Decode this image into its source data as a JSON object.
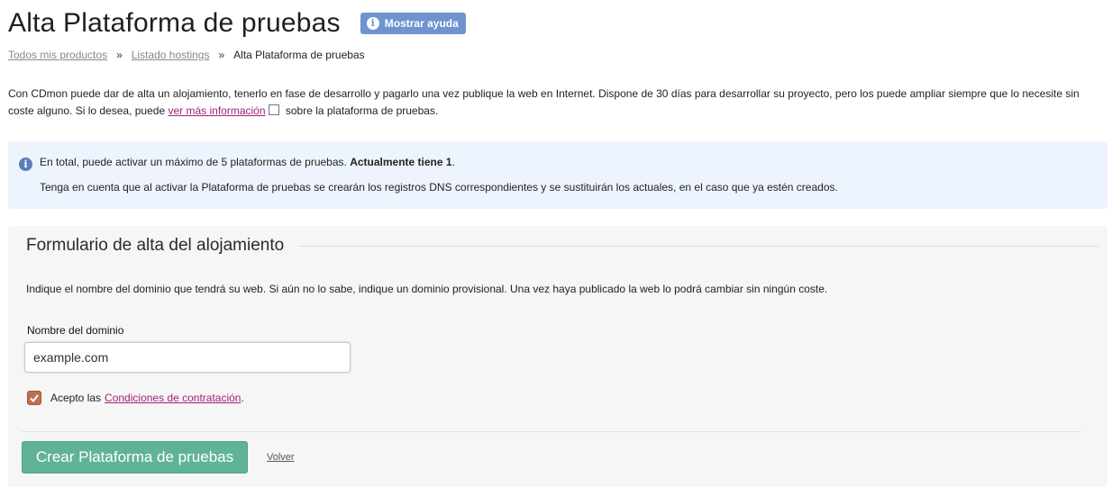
{
  "header": {
    "title": "Alta Plataforma de pruebas",
    "help_button": "Mostrar ayuda"
  },
  "breadcrumb": {
    "items": [
      "Todos mis productos",
      "Listado hostings",
      "Alta Plataforma de pruebas"
    ],
    "separator": "»"
  },
  "intro": {
    "text_before": "Con CDmon puede dar de alta un alojamiento, tenerlo en fase de desarrollo y pagarlo una vez publique la web en Internet. Dispone de 30 días para desarrollar su proyecto, pero los puede ampliar siempre que lo necesite sin coste alguno. Si lo desea, puede ",
    "link": "ver más información",
    "text_after": " sobre la plataforma de pruebas."
  },
  "info_box": {
    "line1_text": "En total, puede activar un máximo de 5 plataformas de pruebas. ",
    "line1_bold": "Actualmente tiene 1",
    "line1_end": ".",
    "line2": "Tenga en cuenta que al activar la Plataforma de pruebas se crearán los registros DNS correspondientes y se sustituirán los actuales, en el caso que ya estén creados."
  },
  "form": {
    "legend": "Formulario de alta del alojamiento",
    "description": "Indique el nombre del dominio que tendrá su web. Si aún no lo sabe, indique un dominio provisional. Una vez haya publicado la web lo podrá cambiar sin ningún coste.",
    "domain_label": "Nombre del dominio",
    "domain_placeholder": "example.com",
    "terms_text": "Acepto las",
    "terms_link": "Condiciones de contratación",
    "terms_end": ".",
    "terms_checked": true,
    "submit": "Crear Plataforma de pruebas",
    "back": "Volver"
  },
  "colors": {
    "help_button": "#6e93cf",
    "info_bg": "#eef4fd",
    "link": "#a0207a",
    "submit": "#60b398",
    "checkbox": "#b9724d"
  }
}
